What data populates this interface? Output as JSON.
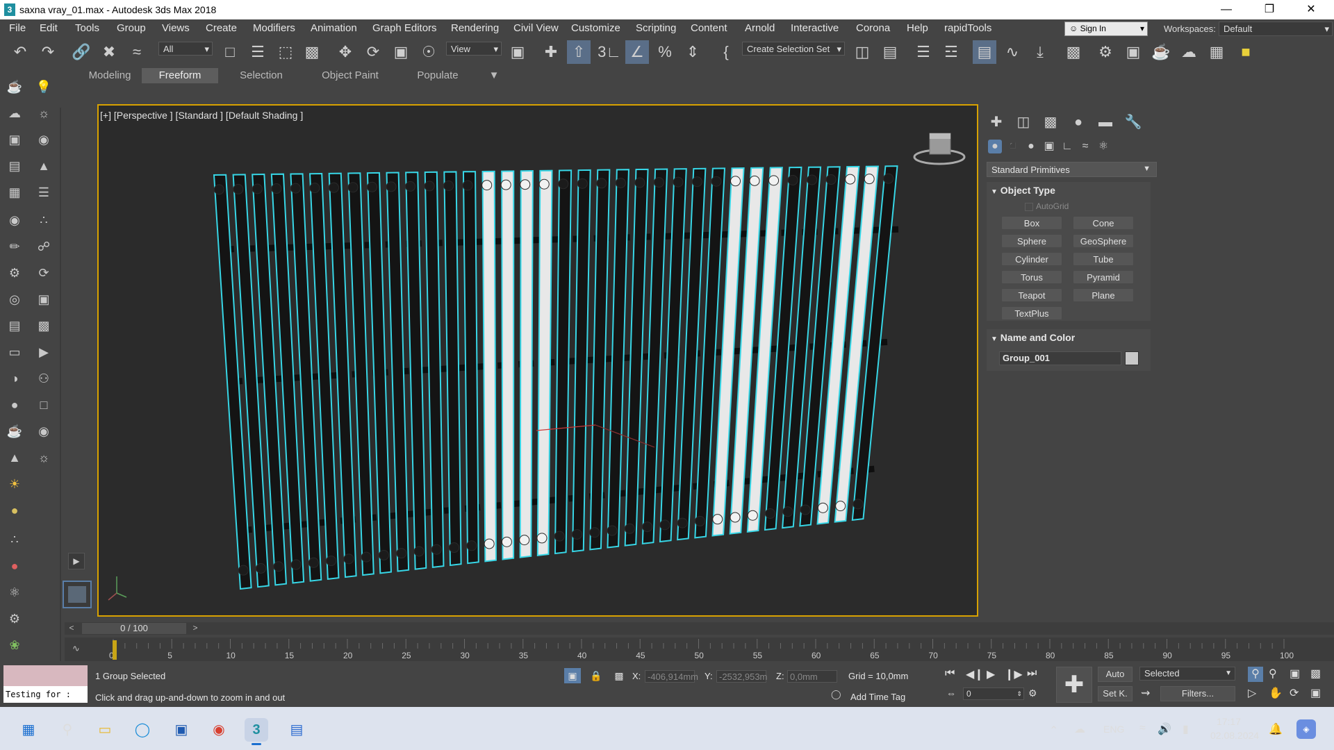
{
  "window": {
    "title": "saxna vray_01.max - Autodesk 3ds Max 2018",
    "app_icon": "3",
    "controls": [
      "—",
      "❐",
      "✕"
    ]
  },
  "menubar": {
    "items": [
      "File",
      "Edit",
      "Tools",
      "Group",
      "Views",
      "Create",
      "Modifiers",
      "Animation",
      "Graph Editors",
      "Rendering",
      "Civil View",
      "Customize",
      "Scripting",
      "Content",
      "Arnold",
      "Interactive",
      "Corona",
      "Help",
      "rapidTools"
    ],
    "sign_in": "Sign In",
    "workspaces_label": "Workspaces:",
    "workspace_value": "Default"
  },
  "toolbar": {
    "filter_value": "All",
    "refcoord_value": "View",
    "selection_set": "Create Selection Set"
  },
  "ribbon": {
    "tabs": [
      "Modeling",
      "Freeform",
      "Selection",
      "Object Paint",
      "Populate"
    ],
    "active": "Freeform"
  },
  "viewport": {
    "label": "[+] [Perspective ] [Standard ] [Default Shading ]",
    "object_color": "#37d6e6"
  },
  "command_panel": {
    "category": "Standard Primitives",
    "object_type_header": "Object Type",
    "autogrid": "AutoGrid",
    "buttons": [
      "Box",
      "Cone",
      "Sphere",
      "GeoSphere",
      "Cylinder",
      "Tube",
      "Torus",
      "Pyramid",
      "Teapot",
      "Plane",
      "TextPlus"
    ],
    "name_color_header": "Name and Color",
    "object_name": "Group_001",
    "object_swatch": "#c8c8c8"
  },
  "timeline": {
    "frame_display": "0 / 100",
    "ticks": [
      "0",
      "5",
      "10",
      "15",
      "20",
      "25",
      "30",
      "35",
      "40",
      "45",
      "50",
      "55",
      "60",
      "65",
      "70",
      "75",
      "80",
      "85",
      "90",
      "95",
      "100"
    ]
  },
  "status": {
    "maxscript": "Testing for :",
    "selection": "1 Group Selected",
    "prompt": "Click and drag up-and-down to zoom in and out",
    "x_label": "X:",
    "x_value": "-406,914mm",
    "y_label": "Y:",
    "y_value": "-2532,953m",
    "z_label": "Z:",
    "z_value": "0,0mm",
    "grid": "Grid = 10,0mm",
    "add_time_tag": "Add Time Tag",
    "frame_spinner": "0",
    "auto_key": "Auto",
    "set_key": "Set K.",
    "key_filter": "Selected",
    "filters": "Filters..."
  },
  "taskbar": {
    "lang": "ENG",
    "time": "17:17",
    "date": "02.08.2024"
  }
}
